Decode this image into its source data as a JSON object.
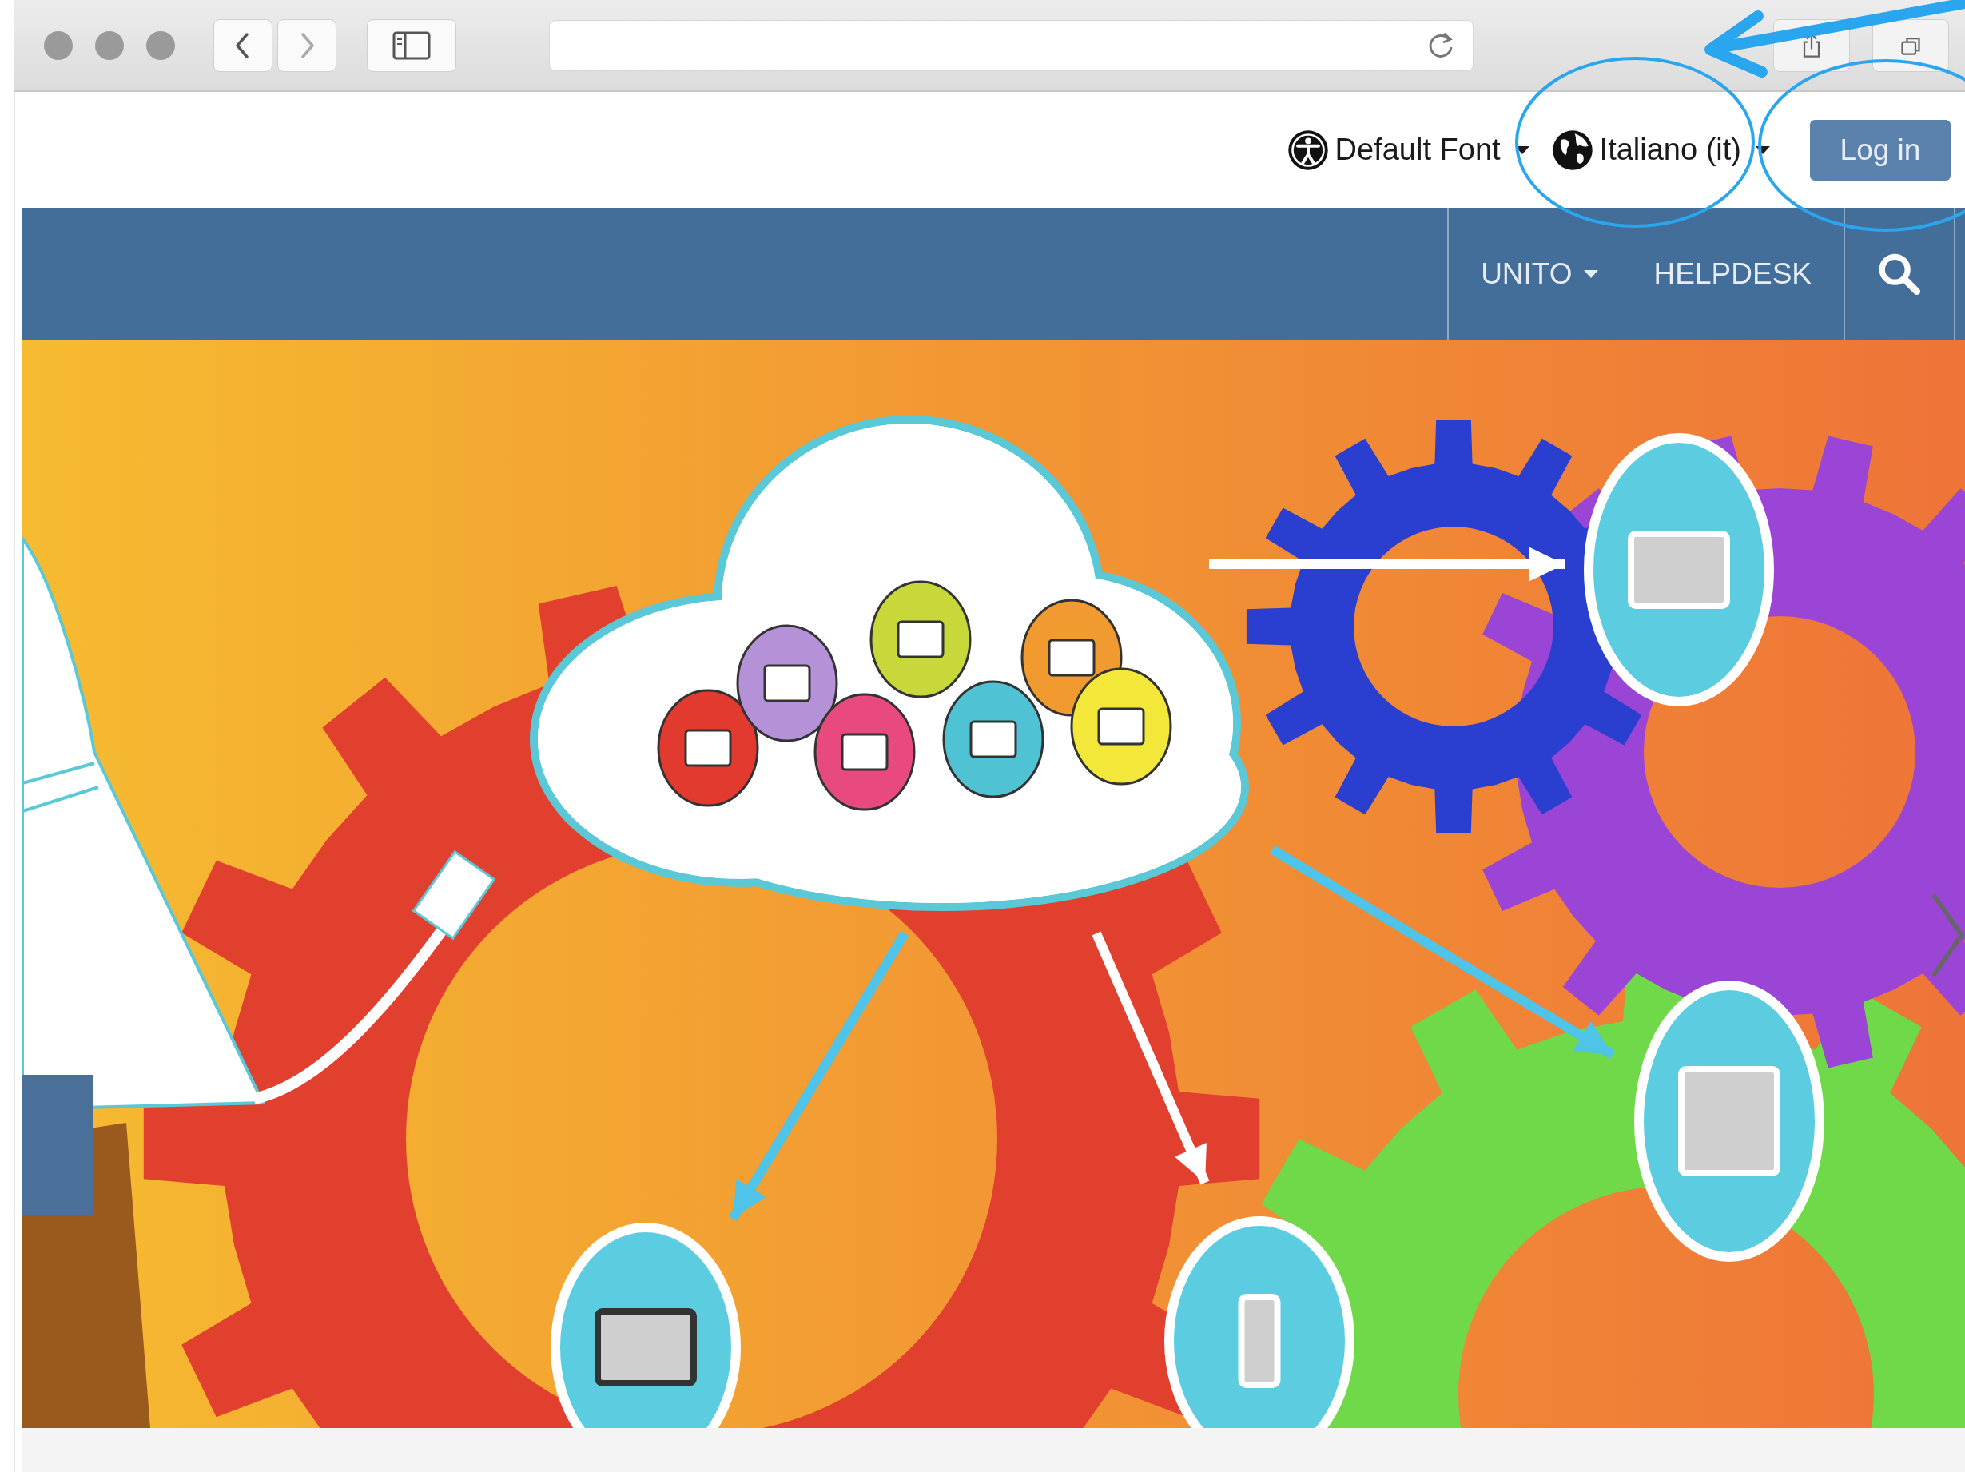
{
  "utility_menus": [
    {
      "kind": "accessibility",
      "label": "Default Font",
      "dropdown": true
    },
    {
      "kind": "language",
      "label": "Italiano (it)",
      "dropdown": true
    }
  ],
  "login_button": {
    "label": "Log in"
  },
  "navbar": {
    "items": [
      {
        "label": "UNITO",
        "dropdown": true
      },
      {
        "label": "HELPDESK",
        "dropdown": false
      }
    ]
  }
}
